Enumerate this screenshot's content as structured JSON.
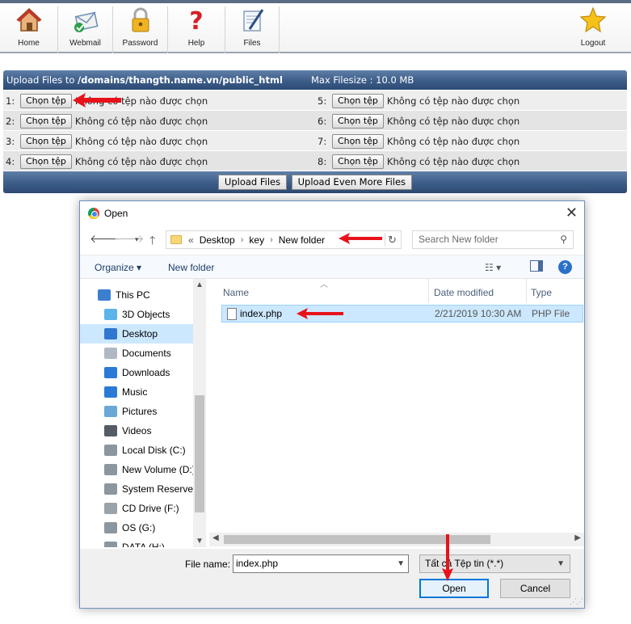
{
  "toolbar": {
    "items": [
      {
        "label": "Home",
        "icon": "house-icon"
      },
      {
        "label": "Webmail",
        "icon": "envelope-icon"
      },
      {
        "label": "Password",
        "icon": "padlock-icon"
      },
      {
        "label": "Help",
        "icon": "question-mark-icon"
      },
      {
        "label": "Files",
        "icon": "file-edit-icon"
      },
      {
        "label": "Logout",
        "icon": "star-icon"
      }
    ]
  },
  "upload": {
    "title_prefix": "Upload Files to",
    "path": "/domains/thangth.name.vn/public_html",
    "max_filesize": "Max Filesize : 10.0 MB",
    "choose_label": "Chọn tệp",
    "no_file_label": "Không có tệp nào được chọn",
    "slots": [
      "1:",
      "2:",
      "3:",
      "4:",
      "5:",
      "6:",
      "7:",
      "8:"
    ],
    "upload_button": "Upload Files",
    "upload_more_button": "Upload Even More Files",
    "row_colors": [
      "#eeeeee",
      "#e4e4e4"
    ],
    "header_color": "#3a5a86"
  },
  "dialog": {
    "title": "Open",
    "close_glyph": "✕",
    "breadcrumb": {
      "overflow": "«",
      "parts": [
        "Desktop",
        "key",
        "New folder"
      ]
    },
    "search_placeholder": "Search New folder",
    "organize_label": "Organize ▾",
    "new_folder_label": "New folder",
    "view_glyph": "☷ ▾",
    "help_glyph": "?",
    "nav_items": [
      {
        "label": "This PC",
        "icon": "computer-icon",
        "color": "#3c7fd0"
      },
      {
        "label": "3D Objects",
        "icon": "cube-icon",
        "color": "#5db4e8"
      },
      {
        "label": "Desktop",
        "icon": "desktop-icon",
        "color": "#2f77d0",
        "selected": true
      },
      {
        "label": "Documents",
        "icon": "document-icon",
        "color": "#b0b8c4"
      },
      {
        "label": "Downloads",
        "icon": "download-icon",
        "color": "#2b7bd6"
      },
      {
        "label": "Music",
        "icon": "music-note-icon",
        "color": "#2b7bd6"
      },
      {
        "label": "Pictures",
        "icon": "picture-icon",
        "color": "#6aa8d8"
      },
      {
        "label": "Videos",
        "icon": "film-icon",
        "color": "#555c66"
      },
      {
        "label": "Local Disk (C:)",
        "icon": "drive-icon",
        "color": "#8c969f"
      },
      {
        "label": "New Volume (D:)",
        "icon": "drive-icon",
        "color": "#8c969f"
      },
      {
        "label": "System Reserved",
        "icon": "drive-icon",
        "color": "#8c969f"
      },
      {
        "label": "CD Drive (F:)",
        "icon": "cd-drive-icon",
        "color": "#9aa2aa"
      },
      {
        "label": "OS (G:)",
        "icon": "drive-icon",
        "color": "#8c969f"
      },
      {
        "label": "DATA (H:)",
        "icon": "drive-icon",
        "color": "#8c969f"
      }
    ],
    "columns": {
      "name": "Name",
      "date": "Date modified",
      "type": "Type"
    },
    "file": {
      "name": "index.php",
      "date": "2/21/2019 10:30 AM",
      "type": "PHP File"
    },
    "filename_label": "File name:",
    "filename_value": "index.php",
    "filetype_value": "Tất cả Tệp tin (*.*)",
    "open_button": "Open",
    "cancel_button": "Cancel"
  },
  "annotation_arrow_color": "#e8121b"
}
